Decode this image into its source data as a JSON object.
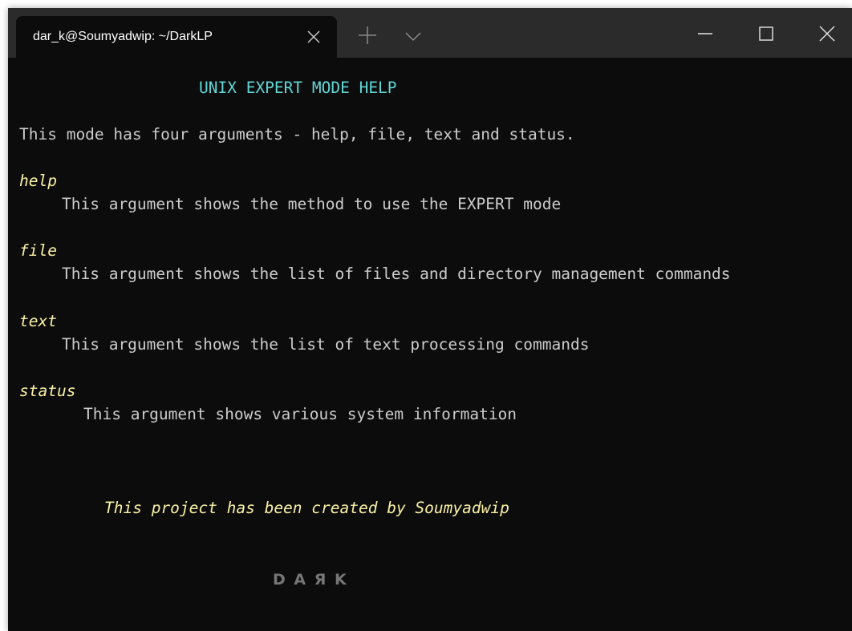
{
  "window": {
    "tab_title": "dar_k@Soumyadwip: ~/DarkLP",
    "tab_close_icon": "close-icon",
    "new_tab_icon": "plus-icon",
    "dropdown_icon": "chevron-down-icon",
    "minimize_icon": "minimize-icon",
    "maximize_icon": "maximize-icon",
    "close_icon": "close-icon"
  },
  "colors": {
    "terminal_bg": "#0c0c0c",
    "titlebar_bg": "#2b2b2b",
    "text": "#cccccc",
    "cyan": "#61d6d6",
    "yellow": "#f9f1a5",
    "gray": "#767676"
  },
  "terminal": {
    "heading": "UNIX EXPERT MODE HELP",
    "intro": "This mode has four arguments - help, file, text and status.",
    "args": [
      {
        "name": "help",
        "description": "This argument shows the method to use the EXPERT mode"
      },
      {
        "name": "file",
        "description": "This argument shows the list of files and directory management commands"
      },
      {
        "name": "text",
        "description": "This argument shows the list of text processing commands"
      },
      {
        "name": "status",
        "description": "This argument shows various system information"
      }
    ],
    "credit": "This project has been created by Soumyadwip",
    "signature": "D A Я K"
  }
}
